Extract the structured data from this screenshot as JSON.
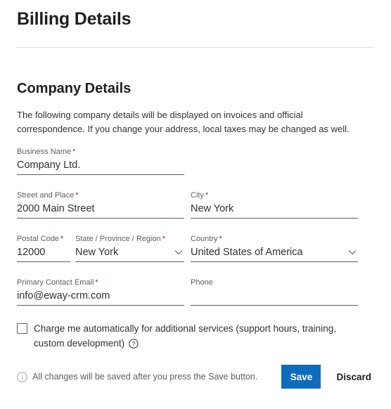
{
  "page": {
    "title": "Billing Details"
  },
  "section": {
    "title": "Company Details",
    "description": "The following company details will be displayed on invoices and official correspondence. If you change your address, local taxes may be changed as well."
  },
  "form": {
    "business_name": {
      "label": "Business Name",
      "required": "*",
      "value": "Company Ltd.",
      "placeholder": ""
    },
    "street": {
      "label": "Street and Place",
      "required": "*",
      "value": "2000 Main Street",
      "placeholder": ""
    },
    "city": {
      "label": "City",
      "required": "*",
      "value": "New York",
      "placeholder": ""
    },
    "postal_code": {
      "label": "Postal Code",
      "required": "*",
      "value": "12000",
      "placeholder": ""
    },
    "state": {
      "label": "State / Province / Region",
      "required": "*",
      "value": "New York",
      "placeholder": "",
      "icon": "chevron-down-icon"
    },
    "country": {
      "label": "Country",
      "required": "*",
      "value": "United States of America",
      "placeholder": "",
      "icon": "chevron-down-icon"
    },
    "email": {
      "label": "Primary Contact Email",
      "required": "*",
      "value": "info@eway-crm.com",
      "placeholder": ""
    },
    "phone": {
      "label": "Phone",
      "required": "",
      "value": "",
      "placeholder": ""
    }
  },
  "checkbox": {
    "label": "Charge me automatically for additional services (support hours, training, custom development)",
    "checked": false,
    "help_icon": "help-circle-icon"
  },
  "footer": {
    "info_icon": "info-circle-icon",
    "note": "All changes will be saved after you press the Save button.",
    "save_label": "Save",
    "discard_label": "Discard"
  },
  "colors": {
    "accent": "#0f6cbd",
    "required": "#a4262c",
    "label": "#605e5c",
    "text": "#323130",
    "divider": "#e1dfdd"
  }
}
